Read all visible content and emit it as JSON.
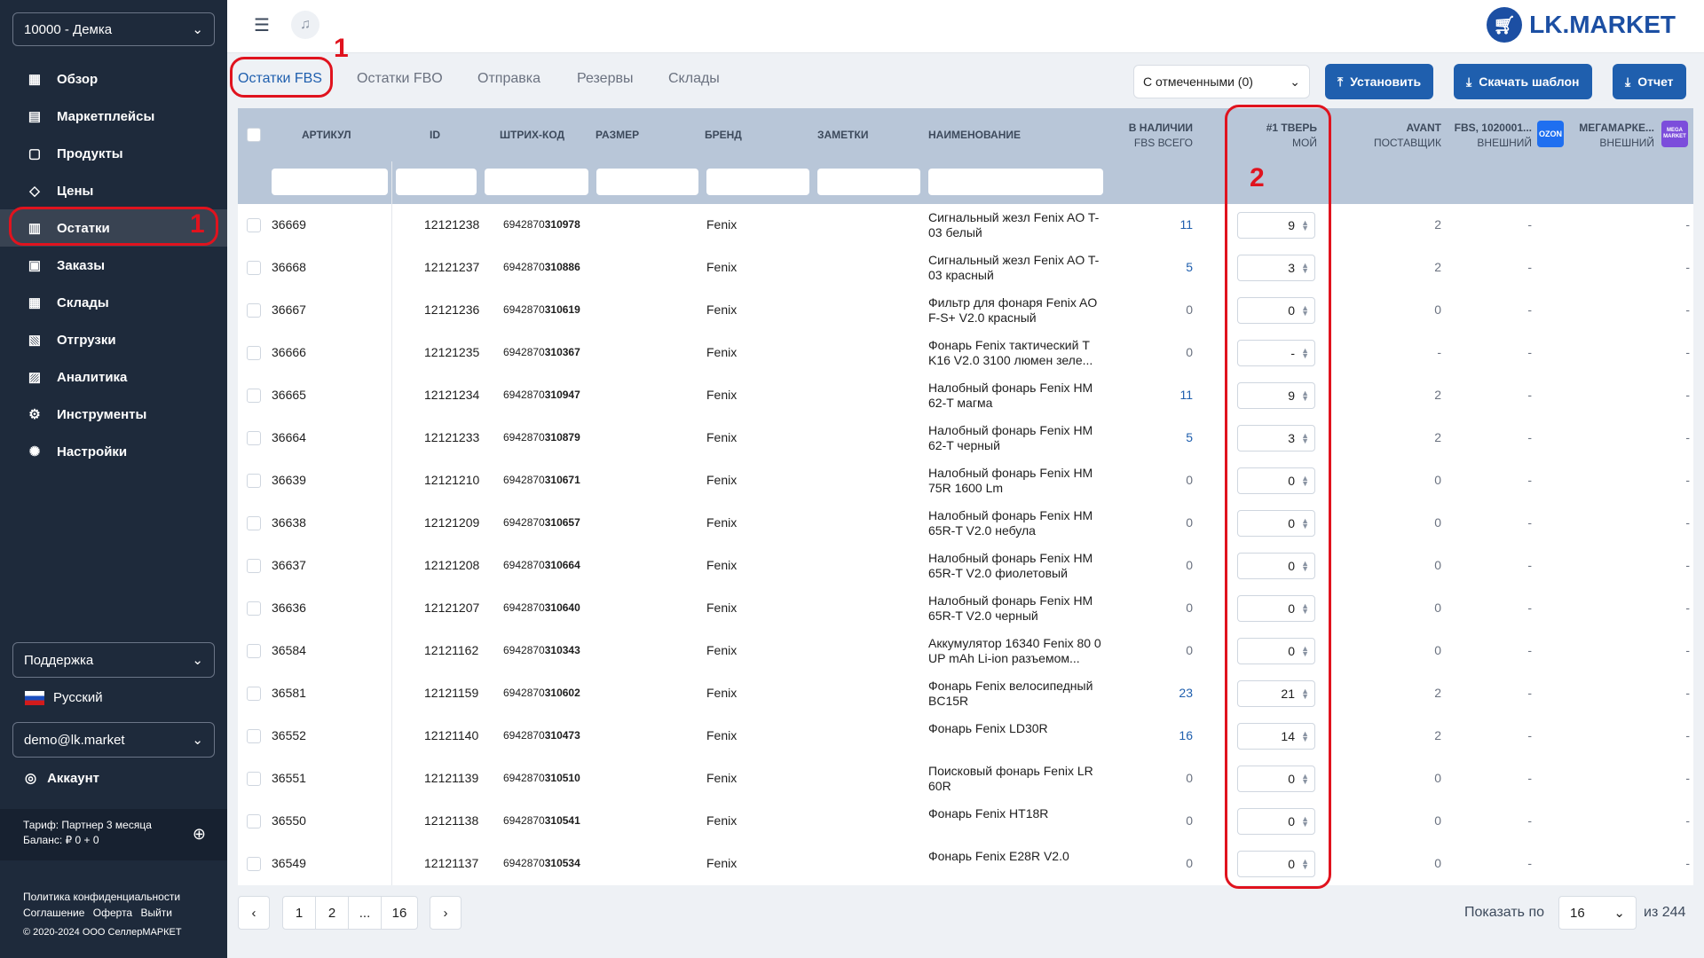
{
  "sidebar": {
    "org": "10000 - Демка",
    "items": [
      {
        "label": "Обзор",
        "icon": "dashboard-icon"
      },
      {
        "label": "Маркетплейсы",
        "icon": "marketplace-icon"
      },
      {
        "label": "Продукты",
        "icon": "product-icon"
      },
      {
        "label": "Цены",
        "icon": "price-tag-icon"
      },
      {
        "label": "Остатки",
        "icon": "stock-icon"
      },
      {
        "label": "Заказы",
        "icon": "orders-icon"
      },
      {
        "label": "Склады",
        "icon": "warehouse-icon"
      },
      {
        "label": "Отгрузки",
        "icon": "shipment-icon"
      },
      {
        "label": "Аналитика",
        "icon": "analytics-icon"
      },
      {
        "label": "Инструменты",
        "icon": "tools-icon"
      },
      {
        "label": "Настройки",
        "icon": "settings-icon"
      }
    ],
    "support": "Поддержка",
    "language": "Русский",
    "user": "demo@lk.market",
    "account": "Аккаунт",
    "tariff": "Тариф: Партнер 3 месяца",
    "balance": "Баланс: ₽ 0 + 0",
    "privacy": "Политика конфиденциальности",
    "agreement": "Соглашение",
    "offer": "Оферта",
    "logout": "Выйти",
    "copyright": "© 2020-2024 ООО СеллерМАРКЕТ"
  },
  "annotations": {
    "one_a": "1",
    "one_b": "1",
    "two": "2"
  },
  "logo": "LK.MARKET",
  "tabs": [
    "Остатки FBS",
    "Остатки FBO",
    "Отправка",
    "Резервы",
    "Склады"
  ],
  "toolbar": {
    "selected": "С отмеченными (0)",
    "set": "Установить",
    "template": "Скачать шаблон",
    "report": "Отчет"
  },
  "columns": {
    "article": "АРТИКУЛ",
    "id": "ID",
    "barcode": "ШТРИХ-КОД",
    "size": "РАЗМЕР",
    "brand": "БРЕНД",
    "notes": "ЗАМЕТКИ",
    "name": "НАИМЕНОВАНИЕ",
    "avail": "В НАЛИЧИИ",
    "avail_sub": "FBS ВСЕГО",
    "tver": "#1 ТВЕРЬ",
    "tver_sub": "МОЙ",
    "avant": "AVANT",
    "avant_sub": "ПОСТАВЩИК",
    "fbs": "FBS, 1020001...",
    "fbs_sub": "ВНЕШНИЙ",
    "mega": "МЕГАМАРКЕ...",
    "mega_sub": "ВНЕШНИЙ",
    "ozon_badge": "OZON",
    "mega_badge": "MEGA MARKET"
  },
  "rows": [
    {
      "article": "36669",
      "id": "12121238",
      "bc_a": "6942870",
      "bc_b": "310978",
      "brand": "Fenix",
      "name": "Сигнальный жезл Fenix AO T-03 белый",
      "avail": "11",
      "tver": "9",
      "avant": "2",
      "fbs": "-",
      "mega": "-"
    },
    {
      "article": "36668",
      "id": "12121237",
      "bc_a": "6942870",
      "bc_b": "310886",
      "brand": "Fenix",
      "name": "Сигнальный жезл Fenix AO T-03 красный",
      "avail": "5",
      "tver": "3",
      "avant": "2",
      "fbs": "-",
      "mega": "-"
    },
    {
      "article": "36667",
      "id": "12121236",
      "bc_a": "6942870",
      "bc_b": "310619",
      "brand": "Fenix",
      "name": "Фильтр для фонаря Fenix AO F-S+ V2.0 красный",
      "avail": "0",
      "tver": "0",
      "avant": "0",
      "fbs": "-",
      "mega": "-"
    },
    {
      "article": "36666",
      "id": "12121235",
      "bc_a": "6942870",
      "bc_b": "310367",
      "brand": "Fenix",
      "name": "Фонарь Fenix тактический T K16 V2.0 3100 люмен зеле...",
      "avail": "0",
      "tver": "-",
      "avant": "-",
      "fbs": "-",
      "mega": "-"
    },
    {
      "article": "36665",
      "id": "12121234",
      "bc_a": "6942870",
      "bc_b": "310947",
      "brand": "Fenix",
      "name": "Налобный фонарь Fenix HM 62-T магма",
      "avail": "11",
      "tver": "9",
      "avant": "2",
      "fbs": "-",
      "mega": "-"
    },
    {
      "article": "36664",
      "id": "12121233",
      "bc_a": "6942870",
      "bc_b": "310879",
      "brand": "Fenix",
      "name": "Налобный фонарь Fenix HM 62-T черный",
      "avail": "5",
      "tver": "3",
      "avant": "2",
      "fbs": "-",
      "mega": "-"
    },
    {
      "article": "36639",
      "id": "12121210",
      "bc_a": "6942870",
      "bc_b": "310671",
      "brand": "Fenix",
      "name": "Налобный фонарь Fenix HM 75R 1600 Lm",
      "avail": "0",
      "tver": "0",
      "avant": "0",
      "fbs": "-",
      "mega": "-"
    },
    {
      "article": "36638",
      "id": "12121209",
      "bc_a": "6942870",
      "bc_b": "310657",
      "brand": "Fenix",
      "name": "Налобный фонарь Fenix HM 65R-T V2.0 небула",
      "avail": "0",
      "tver": "0",
      "avant": "0",
      "fbs": "-",
      "mega": "-"
    },
    {
      "article": "36637",
      "id": "12121208",
      "bc_a": "6942870",
      "bc_b": "310664",
      "brand": "Fenix",
      "name": "Налобный фонарь Fenix HM 65R-T V2.0 фиолетовый",
      "avail": "0",
      "tver": "0",
      "avant": "0",
      "fbs": "-",
      "mega": "-"
    },
    {
      "article": "36636",
      "id": "12121207",
      "bc_a": "6942870",
      "bc_b": "310640",
      "brand": "Fenix",
      "name": "Налобный фонарь Fenix HM 65R-T V2.0 черный",
      "avail": "0",
      "tver": "0",
      "avant": "0",
      "fbs": "-",
      "mega": "-"
    },
    {
      "article": "36584",
      "id": "12121162",
      "bc_a": "6942870",
      "bc_b": "310343",
      "brand": "Fenix",
      "name": "Аккумулятор 16340 Fenix 80 0 UP mAh Li-ion разъемом...",
      "avail": "0",
      "tver": "0",
      "avant": "0",
      "fbs": "-",
      "mega": "-"
    },
    {
      "article": "36581",
      "id": "12121159",
      "bc_a": "6942870",
      "bc_b": "310602",
      "brand": "Fenix",
      "name": "Фонарь Fenix велосипедный BC15R",
      "avail": "23",
      "tver": "21",
      "avant": "2",
      "fbs": "-",
      "mega": "-"
    },
    {
      "article": "36552",
      "id": "12121140",
      "bc_a": "6942870",
      "bc_b": "310473",
      "brand": "Fenix",
      "name": "Фонарь Fenix LD30R",
      "avail": "16",
      "tver": "14",
      "avant": "2",
      "fbs": "-",
      "mega": "-"
    },
    {
      "article": "36551",
      "id": "12121139",
      "bc_a": "6942870",
      "bc_b": "310510",
      "brand": "Fenix",
      "name": "Поисковый фонарь Fenix LR 60R",
      "avail": "0",
      "tver": "0",
      "avant": "0",
      "fbs": "-",
      "mega": "-"
    },
    {
      "article": "36550",
      "id": "12121138",
      "bc_a": "6942870",
      "bc_b": "310541",
      "brand": "Fenix",
      "name": "Фонарь Fenix HT18R",
      "avail": "0",
      "tver": "0",
      "avant": "0",
      "fbs": "-",
      "mega": "-"
    },
    {
      "article": "36549",
      "id": "12121137",
      "bc_a": "6942870",
      "bc_b": "310534",
      "brand": "Fenix",
      "name": "Фонарь Fenix E28R V2.0",
      "avail": "0",
      "tver": "0",
      "avant": "0",
      "fbs": "-",
      "mega": "-"
    }
  ],
  "pagination": {
    "pages": [
      "1",
      "2",
      "...",
      "16"
    ],
    "show_label": "Показать по",
    "per_page": "16",
    "total": "из 244"
  },
  "colors": {
    "sidebar": "#1e2a3b",
    "accent": "#1f5fae",
    "highlight": "#e0131e",
    "header": "#b8c6d8"
  }
}
